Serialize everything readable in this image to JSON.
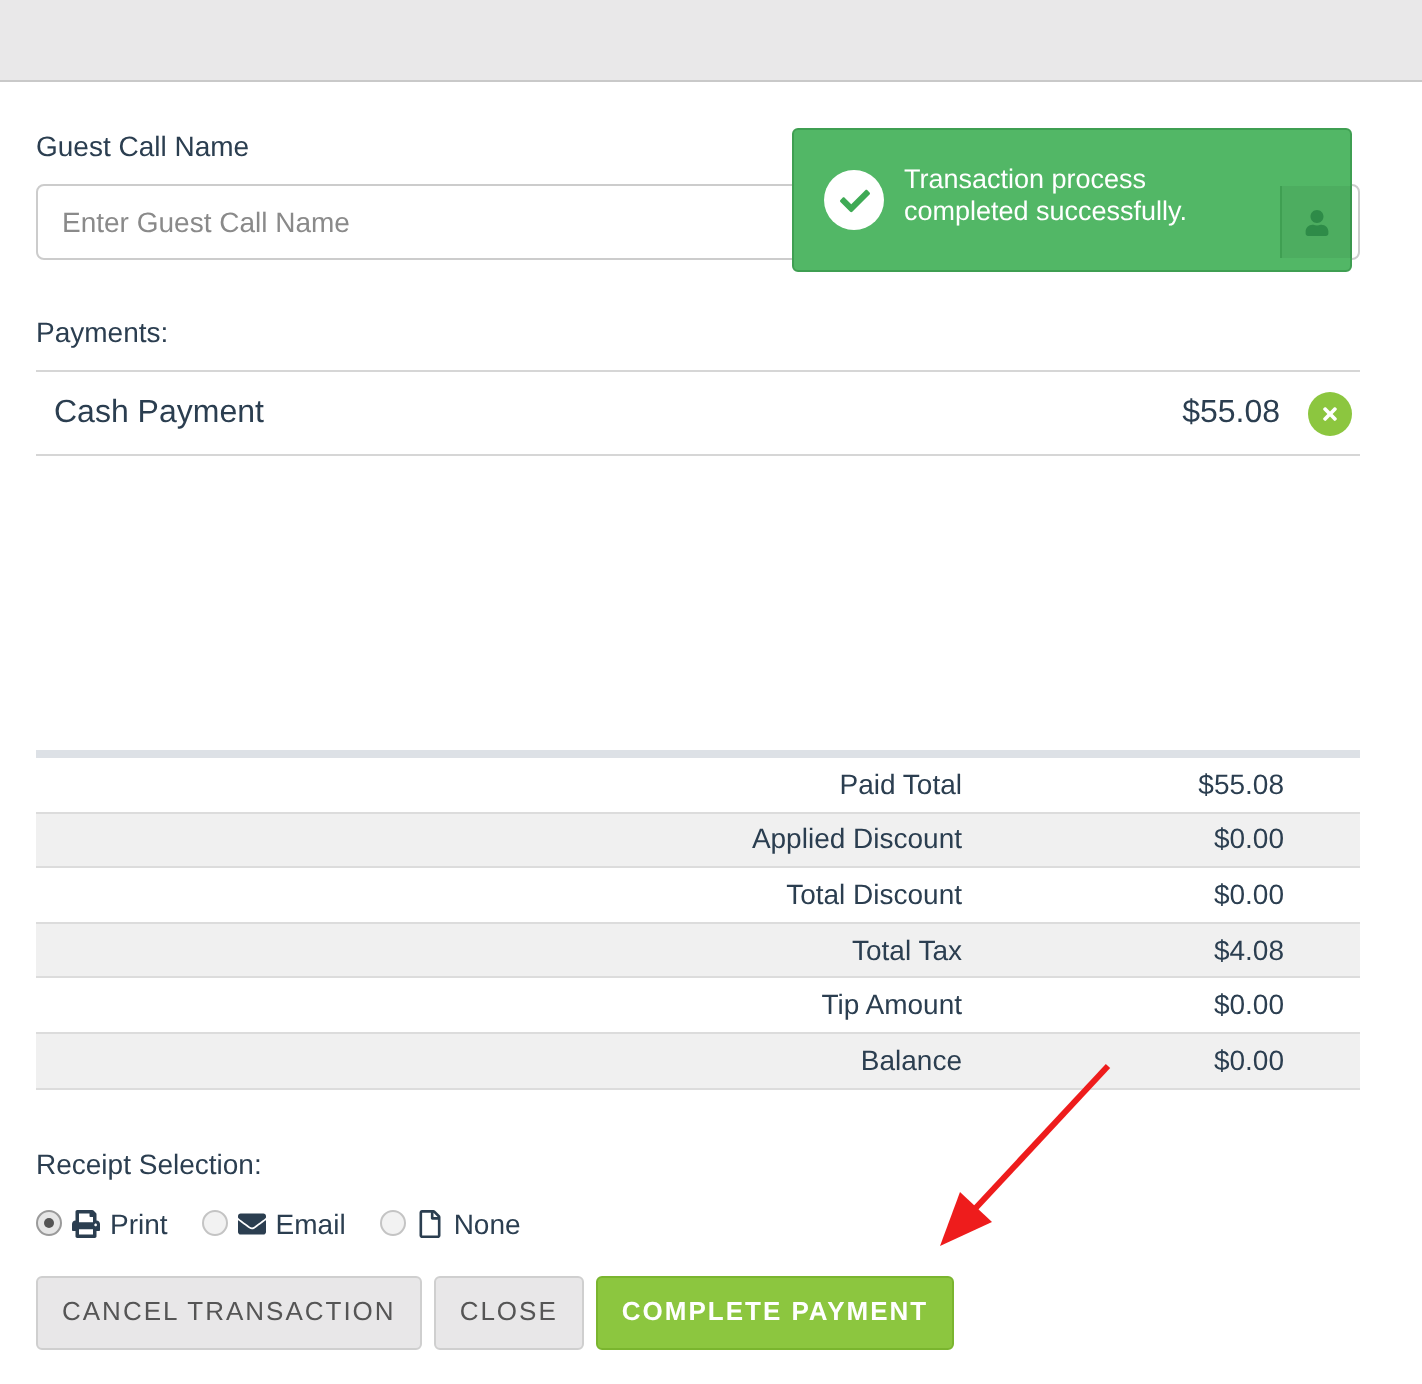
{
  "guest_call_name": {
    "label": "Guest Call Name",
    "placeholder": "Enter Guest Call Name"
  },
  "toast": {
    "message": "Transaction process completed successfully."
  },
  "payments": {
    "label": "Payments:",
    "items": [
      {
        "name": "Cash Payment",
        "amount": "$55.08"
      }
    ]
  },
  "totals": [
    {
      "label": "Paid Total",
      "value": "$55.08"
    },
    {
      "label": "Applied Discount",
      "value": "$0.00"
    },
    {
      "label": "Total Discount",
      "value": "$0.00"
    },
    {
      "label": "Total Tax",
      "value": "$4.08"
    },
    {
      "label": "Tip Amount",
      "value": "$0.00"
    },
    {
      "label": "Balance",
      "value": "$0.00"
    }
  ],
  "receipt_selection": {
    "label": "Receipt Selection:",
    "options": [
      {
        "label": "Print",
        "selected": true
      },
      {
        "label": "Email",
        "selected": false
      },
      {
        "label": "None",
        "selected": false
      }
    ]
  },
  "buttons": [
    {
      "label": "CANCEL TRANSACTION",
      "kind": "default"
    },
    {
      "label": "CLOSE",
      "kind": "default"
    },
    {
      "label": "COMPLETE PAYMENT",
      "kind": "primary"
    }
  ]
}
